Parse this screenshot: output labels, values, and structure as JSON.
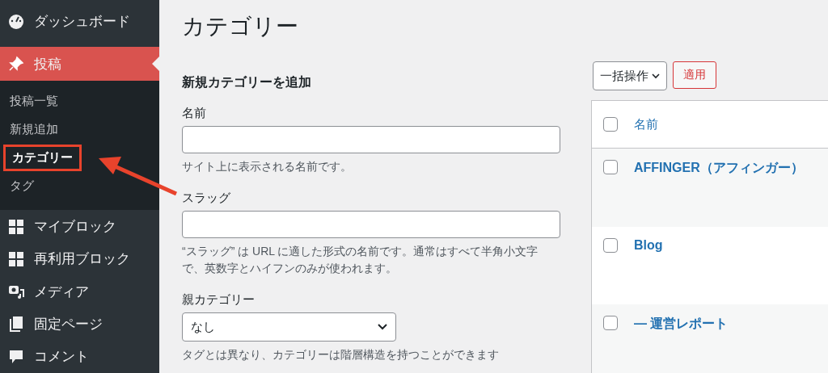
{
  "sidebar": {
    "items": [
      {
        "label": "ダッシュボード",
        "kind": "dashboard",
        "selected": false
      },
      {
        "label": "投稿",
        "kind": "posts",
        "selected": true,
        "children": [
          {
            "label": "投稿一覧",
            "selected": false
          },
          {
            "label": "新規追加",
            "selected": false
          },
          {
            "label": "カテゴリー",
            "selected": true,
            "highlighted": true
          },
          {
            "label": "タグ",
            "selected": false
          }
        ]
      },
      {
        "label": "マイブロック",
        "kind": "blocks",
        "selected": false
      },
      {
        "label": "再利用ブロック",
        "kind": "blocks",
        "selected": false
      },
      {
        "label": "メディア",
        "kind": "media",
        "selected": false
      },
      {
        "label": "固定ページ",
        "kind": "pages",
        "selected": false
      },
      {
        "label": "コメント",
        "kind": "comments",
        "selected": false
      }
    ]
  },
  "page_title": "カテゴリー",
  "form": {
    "heading": "新規カテゴリーを追加",
    "fields": [
      {
        "kind": "text",
        "label": "名前",
        "help": "サイト上に表示される名前です。"
      },
      {
        "kind": "text",
        "label": "スラッグ",
        "help": "“スラッグ” は URL に適した形式の名前です。通常はすべて半角小文字で、英数字とハイフンのみが使われます。"
      },
      {
        "kind": "select",
        "label": "親カテゴリー",
        "value": "なし",
        "help": "タグとは異なり、カテゴリーは階層構造を持つことができます"
      }
    ]
  },
  "bulk": {
    "select": "一括操作",
    "apply": "適用"
  },
  "table": {
    "columns": [
      "名前"
    ],
    "header_checked": false,
    "rows": [
      {
        "name": "AFFINGER（アフィンガー）",
        "checked": false
      },
      {
        "name": "Blog",
        "checked": false
      },
      {
        "name": "— 運営レポート",
        "checked": false
      }
    ]
  }
}
